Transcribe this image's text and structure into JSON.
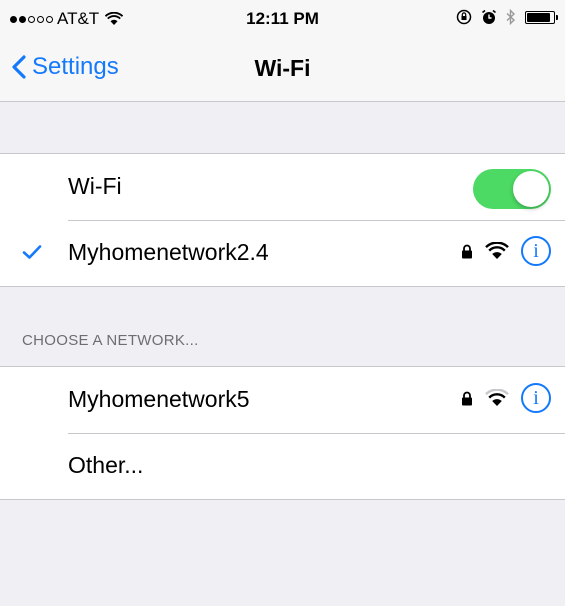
{
  "status_bar": {
    "carrier": "AT&T",
    "signal_bars_filled": 2,
    "signal_bars_total": 5,
    "time": "12:11 PM",
    "battery_level": 0.9
  },
  "nav": {
    "back_label": "Settings",
    "title": "Wi-Fi"
  },
  "wifi_toggle": {
    "label": "Wi-Fi",
    "on": true,
    "color": "#4cd964"
  },
  "connected_network": {
    "name": "Myhomenetwork2.4",
    "secured": true,
    "icons": [
      "checkmark-icon",
      "lock-icon",
      "wifi-signal-icon",
      "info-icon"
    ]
  },
  "choose_network": {
    "header": "CHOOSE A NETWORK...",
    "networks": [
      {
        "name": "Myhomenetwork5",
        "secured": true
      },
      {
        "name": "Other..."
      }
    ]
  },
  "colors": {
    "accent": "#1479fb",
    "background": "#efeff4",
    "separator": "#c8c7cc"
  }
}
